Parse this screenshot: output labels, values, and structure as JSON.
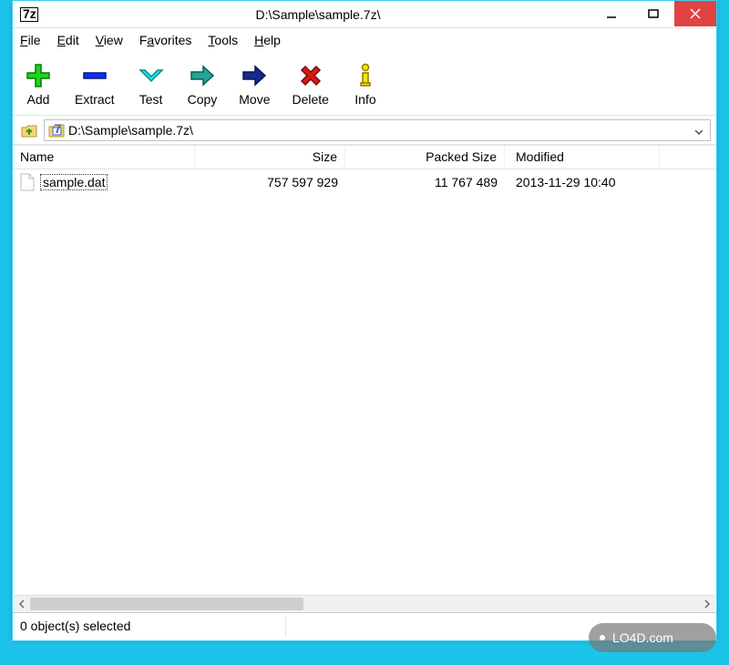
{
  "window": {
    "title": "D:\\Sample\\sample.7z\\"
  },
  "menubar": {
    "items": [
      {
        "hotkey": "F",
        "rest": "ile"
      },
      {
        "hotkey": "E",
        "rest": "dit"
      },
      {
        "hotkey": "V",
        "rest": "iew"
      },
      {
        "hotkey": "a",
        "before": "F",
        "rest": "vorites"
      },
      {
        "hotkey": "T",
        "rest": "ools"
      },
      {
        "hotkey": "H",
        "rest": "elp"
      }
    ]
  },
  "toolbar": {
    "buttons": [
      {
        "id": "add",
        "label": "Add"
      },
      {
        "id": "extract",
        "label": "Extract"
      },
      {
        "id": "test",
        "label": "Test"
      },
      {
        "id": "copy",
        "label": "Copy"
      },
      {
        "id": "move",
        "label": "Move"
      },
      {
        "id": "delete",
        "label": "Delete"
      },
      {
        "id": "info",
        "label": "Info"
      }
    ]
  },
  "addressbar": {
    "path": "D:\\Sample\\sample.7z\\"
  },
  "listview": {
    "columns": {
      "name": "Name",
      "size": "Size",
      "packed": "Packed Size",
      "modified": "Modified"
    },
    "rows": [
      {
        "name": "sample.dat",
        "size": "757 597 929",
        "packed": "11 767 489",
        "modified": "2013-11-29 10:40"
      }
    ]
  },
  "statusbar": {
    "text": "0 object(s) selected"
  },
  "watermark": {
    "text": "LO4D.com"
  }
}
